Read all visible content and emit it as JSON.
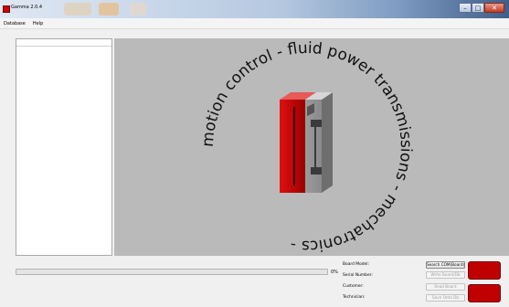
{
  "window": {
    "title": "Gamma 2.0.4"
  },
  "menu": [
    {
      "label": "Database"
    },
    {
      "label": "Help"
    }
  ],
  "logo": {
    "ring_text": "motion control - fluid power transmissions - mechatronics - "
  },
  "progress": {
    "value": 0,
    "label": "0%"
  },
  "board_info": {
    "board_model_label": "Board Model:",
    "serial_number_label": "Serial Number:",
    "customer_label": "Customer:",
    "technician_label": "Technician:"
  },
  "buttons": {
    "search_com": "Search COM(Board)",
    "write_board": "Write Board/Db",
    "read_board": "Read Board",
    "save_onto_db": "Save Onto Db"
  },
  "colors": {
    "accent": "#c00000",
    "logo_gray": "#a6a6a6",
    "view_bg": "#bababa"
  }
}
